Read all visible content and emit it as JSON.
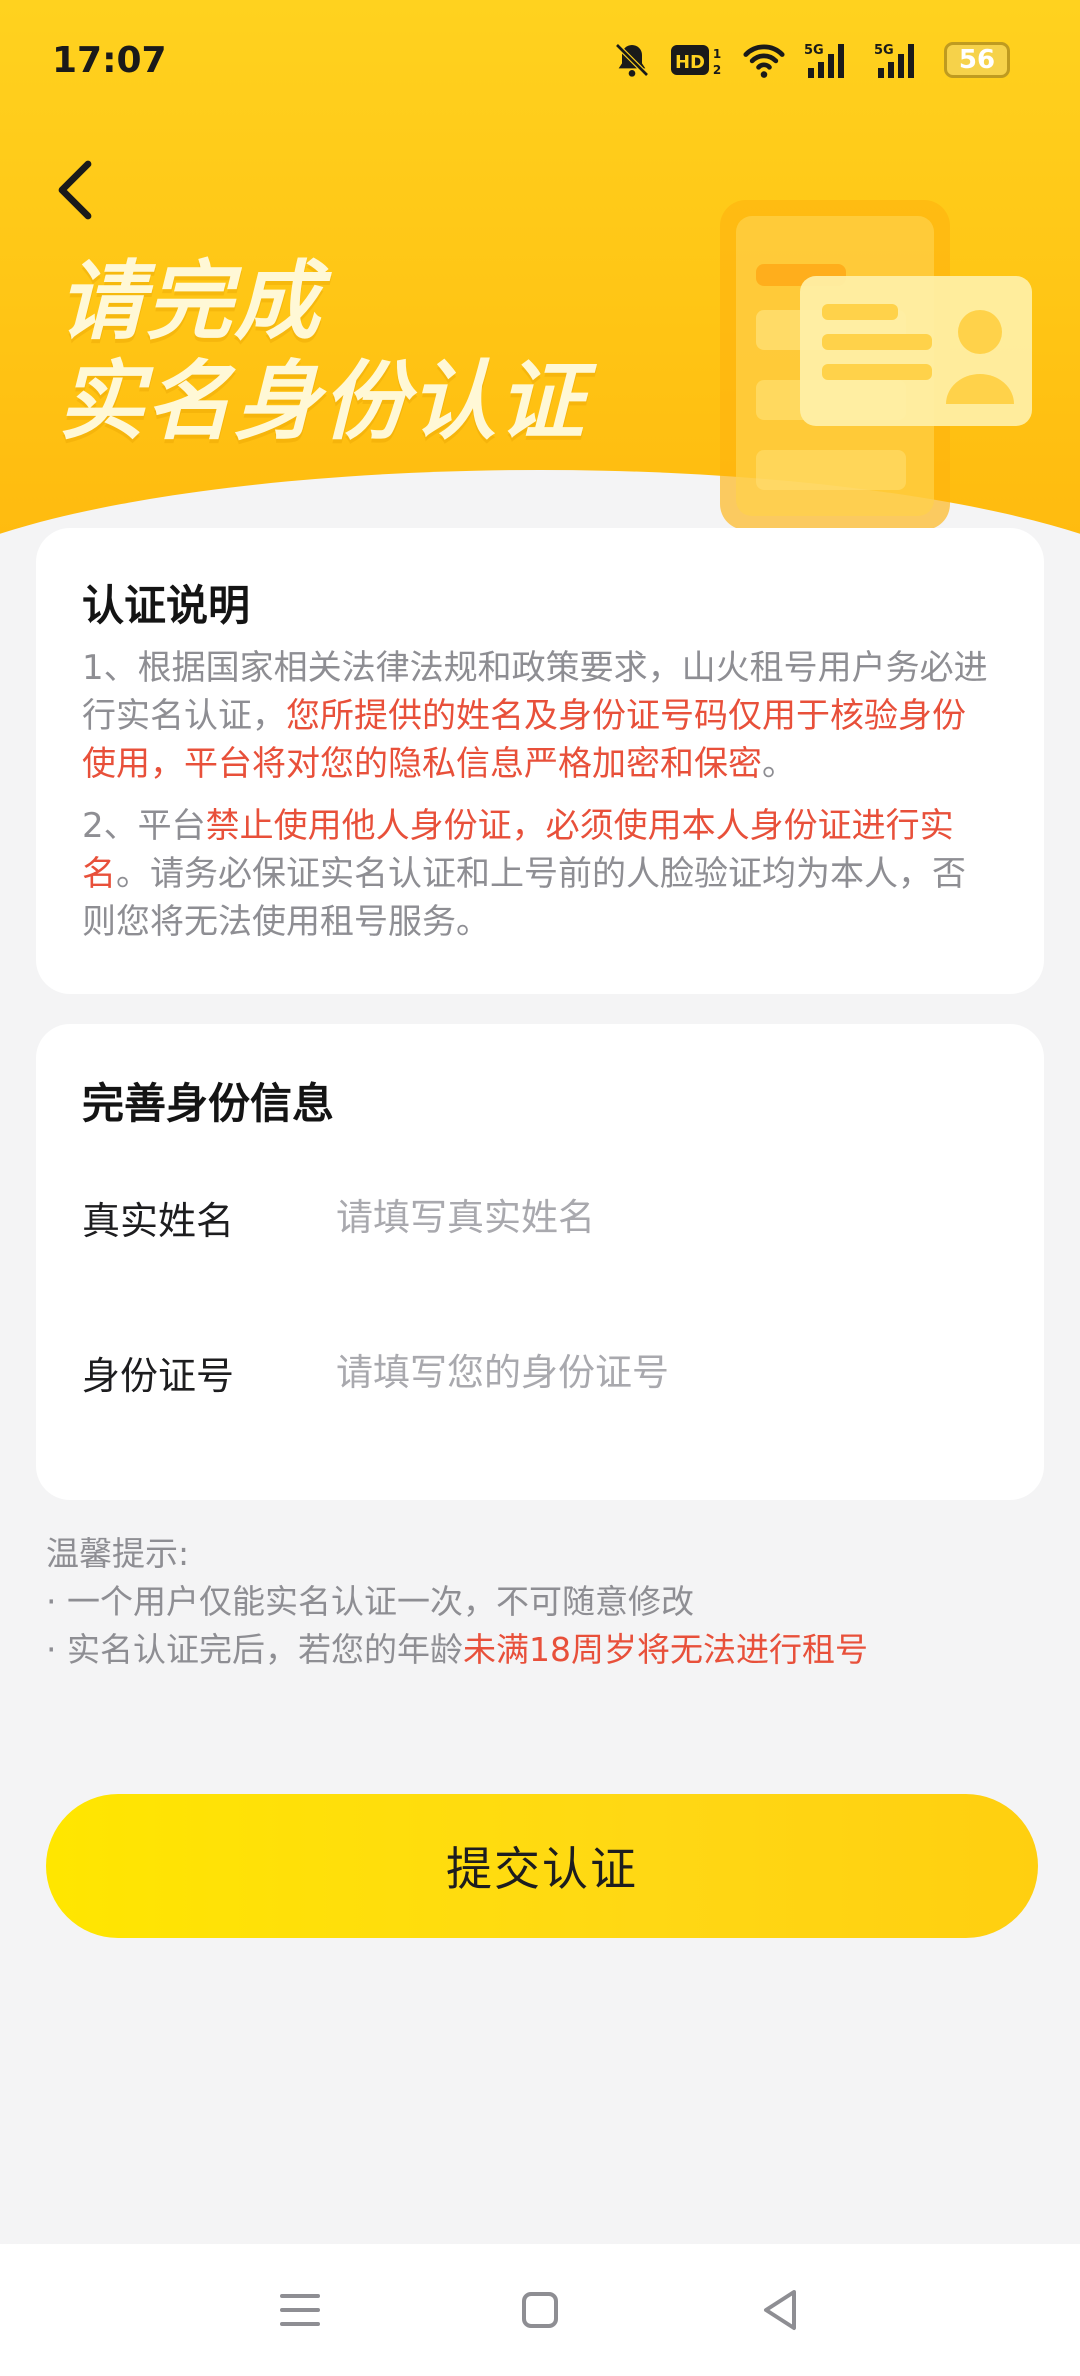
{
  "status_bar": {
    "time": "17:07",
    "battery": "56",
    "icons": [
      "mute-bell-icon",
      "hd-icon",
      "wifi-icon",
      "5g-signal-icon",
      "5g-signal-icon",
      "battery-icon"
    ]
  },
  "header": {
    "back_icon": "chevron-left-icon",
    "hero_line1": "请完成",
    "hero_line2": "实名身份认证"
  },
  "notice": {
    "title": "认证说明",
    "p1_a": "1、根据国家相关法律法规和政策要求，山火租号用户务必进行实名认证，",
    "p1_b": "您所提供的姓名及身份证号码仅用于核验身份使用，平台将对您的隐私信息严格加密和保密",
    "p1_c": "。",
    "p2_a": "2、平台",
    "p2_b": "禁止使用他人身份证，必须使用本人身份证进行实名",
    "p2_c": "。请务必保证实名认证和上号前的人脸验证均为本人，否则您将无法使用租号服务。"
  },
  "identity": {
    "title": "完善身份信息",
    "name_label": "真实姓名",
    "name_placeholder": "请填写真实姓名",
    "id_label": "身份证号",
    "id_placeholder": "请填写您的身份证号"
  },
  "tips": {
    "title": "温馨提示:",
    "item1": "· 一个用户仅能实名认证一次，不可随意修改",
    "item2_a": "· 实名认证完后，若您的年龄",
    "item2_b": "未满18周岁将无法进行租号"
  },
  "submit_label": "提交认证",
  "colors": {
    "accent_yellow": "#ffd814",
    "warning_red": "#e8503a"
  },
  "nav": {
    "icons": [
      "menu-icon",
      "home-square-icon",
      "back-triangle-icon"
    ]
  }
}
